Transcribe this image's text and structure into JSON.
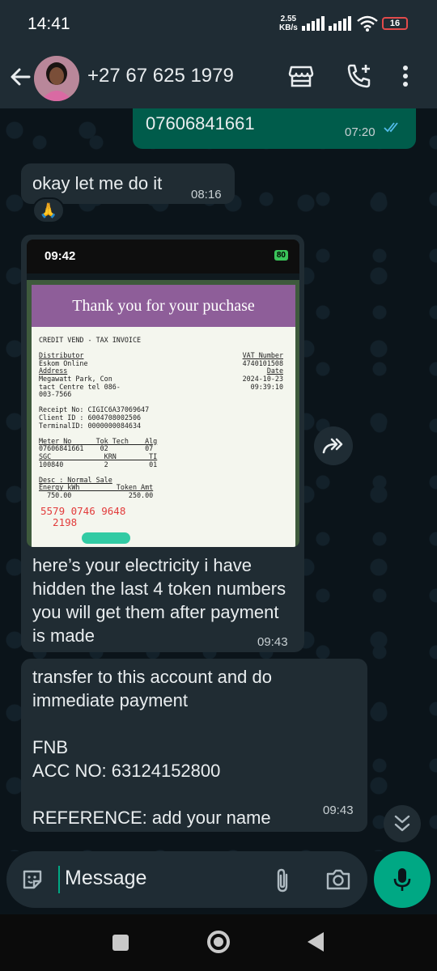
{
  "status": {
    "time": "14:41",
    "speed_value": "2.55",
    "speed_unit": "KB/s",
    "battery": "16"
  },
  "contact": {
    "name": "+27 67 625 1979"
  },
  "messages": [
    {
      "id": "m1",
      "direction": "outgoing",
      "text": "07606841661",
      "time": "07:20",
      "status": "read"
    },
    {
      "id": "m2",
      "direction": "incoming",
      "text": "okay let me do it",
      "time": "08:16",
      "reaction": "🙏"
    },
    {
      "id": "m3",
      "direction": "incoming",
      "type": "image",
      "caption": "here’s your electricity i have hidden the last 4 token numbers you will get them after payment is made",
      "time": "09:43"
    },
    {
      "id": "m4",
      "direction": "incoming",
      "lines": [
        "transfer to this account and do",
        "immediate payment",
        "",
        "FNB",
        "ACC NO: 63124152800",
        "",
        "REFERENCE: add your name"
      ],
      "time": "09:43"
    }
  ],
  "receipt": {
    "phone_time": "09:42",
    "phone_battery": "80",
    "header": "Thank you for your puchase",
    "title": "CREDIT VEND - TAX INVOICE",
    "distributor_label": "Distributor",
    "vat_label": "VAT Number",
    "distributor": "Eskom Online",
    "vat_number": "4740101508",
    "address_label": "Address",
    "date_label": "Date",
    "address_line1": "Megawatt Park, Con",
    "date": "2024-10-23",
    "address_line2": "tact Centre tel 086-",
    "time": "09:39:10",
    "address_line3": "003-7566",
    "receipt_no": "Receipt No: CIGIC6A37069647",
    "client_id": "Client ID : 6004708002506",
    "terminal_id": "TerminalID: 0000000084634",
    "meter_head": "Meter No      Tok Tech    Alg",
    "meter_row": "07606841661    02         07",
    "sgc_head": "SGC             KRN        TI",
    "sgc_row": "100840          2          01",
    "desc": "Desc : Normal Sale",
    "energy_head": "Energy kWh         Token Amt",
    "energy_row": "  750.00              250.00",
    "token_line1": "5579 0746 9648",
    "token_line2": "  2198"
  },
  "composer": {
    "placeholder": "Message"
  },
  "colors": {
    "outgoing_bubble": "#005c4b",
    "incoming_bubble": "#202c33",
    "accent": "#00a884",
    "read_ticks": "#53bdeb"
  }
}
